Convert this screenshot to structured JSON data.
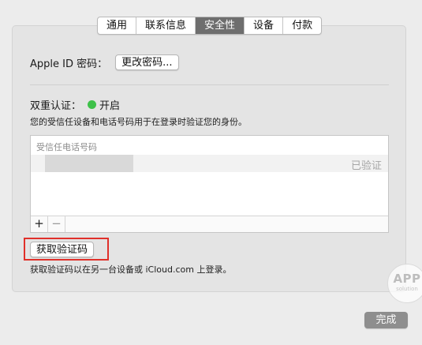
{
  "tabs": [
    {
      "label": "通用",
      "active": false
    },
    {
      "label": "联系信息",
      "active": false
    },
    {
      "label": "安全性",
      "active": true
    },
    {
      "label": "设备",
      "active": false
    },
    {
      "label": "付款",
      "active": false
    }
  ],
  "appleid": {
    "label": "Apple ID 密码：",
    "change_button": "更改密码..."
  },
  "two_factor": {
    "label": "双重认证：",
    "status": "开启",
    "status_color": "#3fc14a",
    "description": "您的受信任设备和电话号码用于在登录时验证您的身份。"
  },
  "trusted_list": {
    "header": "受信任电话号码",
    "rows": [
      {
        "verified": "已验证"
      }
    ],
    "add_label": "+",
    "remove_label": "−"
  },
  "get_code": {
    "button": "获取验证码",
    "description": "获取验证码以在另一台设备或 iCloud.com 上登录。",
    "highlight_color": "#e0302a"
  },
  "watermark": {
    "top": "APP",
    "bottom": "solution"
  },
  "footer": {
    "done_button": "完成"
  }
}
